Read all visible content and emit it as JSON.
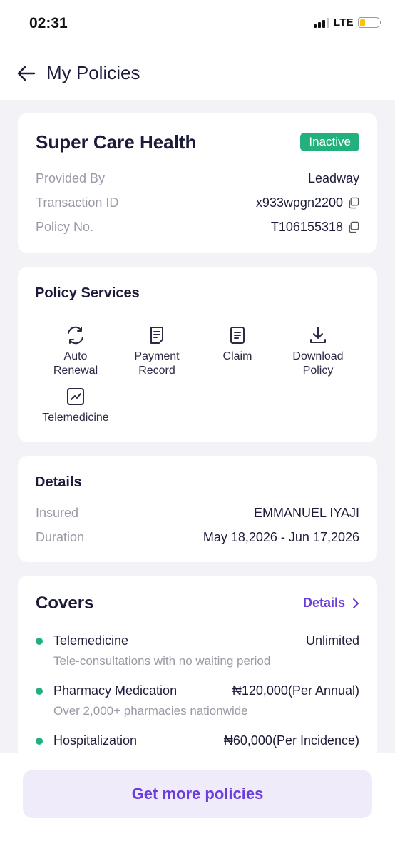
{
  "status_bar": {
    "time": "02:31",
    "network": "LTE"
  },
  "header": {
    "title": "My Policies"
  },
  "policy": {
    "name": "Super Care Health",
    "status": "Inactive",
    "rows": [
      {
        "label": "Provided By",
        "value": "Leadway",
        "copyable": false
      },
      {
        "label": "Transaction ID",
        "value": "x933wpgn2200",
        "copyable": true
      },
      {
        "label": "Policy No.",
        "value": "T106155318",
        "copyable": true
      }
    ]
  },
  "services": {
    "title": "Policy Services",
    "items": [
      {
        "label_1": "Auto",
        "label_2": "Renewal",
        "icon": "refresh-icon"
      },
      {
        "label_1": "Payment",
        "label_2": "Record",
        "icon": "receipt-icon"
      },
      {
        "label_1": "Claim",
        "label_2": "",
        "icon": "document-icon"
      },
      {
        "label_1": "Download",
        "label_2": "Policy",
        "icon": "download-icon"
      },
      {
        "label_1": "Telemedicine",
        "label_2": "",
        "icon": "chart-icon"
      }
    ]
  },
  "details": {
    "title": "Details",
    "rows": [
      {
        "label": "Insured",
        "value": "EMMANUEL IYAJI"
      },
      {
        "label": "Duration",
        "value": "May 18,2026 - Jun 17,2026"
      }
    ]
  },
  "covers": {
    "title": "Covers",
    "link_label": "Details",
    "items": [
      {
        "name": "Telemedicine",
        "amount": "Unlimited",
        "description": "Tele-consultations with no waiting period"
      },
      {
        "name": "Pharmacy Medication",
        "amount": "₦120,000(Per Annual)",
        "description": "Over 2,000+ pharmacies nationwide"
      },
      {
        "name": "Hospitalization",
        "amount": "₦60,000(Per Incidence)",
        "description": ""
      }
    ]
  },
  "cta": {
    "label": "Get more policies"
  },
  "colors": {
    "accent": "#6a3ddb",
    "success": "#22b07d",
    "battery": "#f7c600"
  }
}
